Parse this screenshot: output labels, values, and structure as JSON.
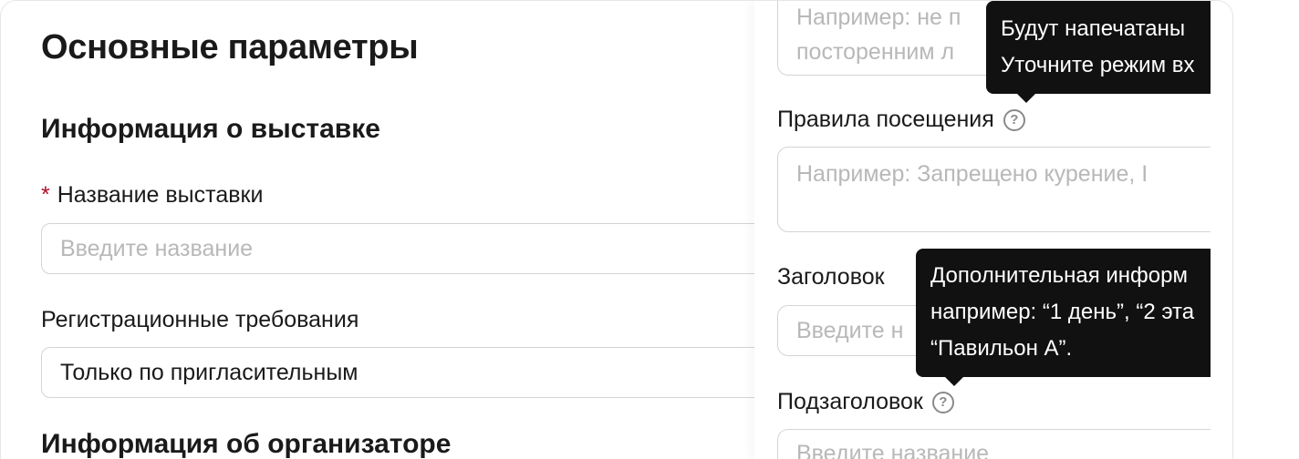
{
  "main": {
    "title": "Основные параметры",
    "section_exhibition": "Информация о выставке",
    "name_field": {
      "required_mark": "*",
      "label": "Название выставки",
      "placeholder": "Введите название"
    },
    "registration_field": {
      "label": "Регистрационные требования",
      "value": "Только по пригласительным"
    },
    "section_organizer": "Информация об организаторе"
  },
  "panel": {
    "top_textarea_placeholder_line1": "Например: не п",
    "top_textarea_placeholder_line2": "посторенним л",
    "tooltip1": {
      "line1": "Будут напечатаны",
      "line2": "Уточните режим вх"
    },
    "rules_label": "Правила посещения",
    "rules_help_icon": "?",
    "rules_placeholder": "Например: Запрещено курение, I",
    "heading_label": "Заголовок",
    "heading_placeholder": "Введите н",
    "tooltip2": {
      "line1": "Дополнительная информ",
      "line2": "например: “1 день”, “2 эта",
      "line3": "“Павильон А”."
    },
    "subheading_label": "Подзаголовок",
    "subheading_help_icon": "?",
    "subheading_placeholder": "Введите название"
  }
}
